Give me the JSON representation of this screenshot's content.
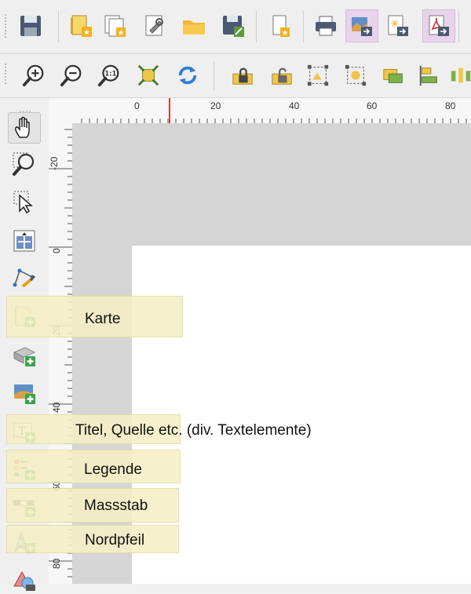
{
  "labels": {
    "karte": "Karte",
    "titel": "Titel, Quelle etc. (div. Textelemente)",
    "legende": "Legende",
    "massstab": "Massstab",
    "nordpfeil": "Nordpfeil"
  },
  "ruler": {
    "h": [
      "0",
      "20",
      "40",
      "60",
      "80"
    ],
    "v": [
      "-20",
      "0",
      "20",
      "40",
      "60",
      "80"
    ]
  },
  "zoom_label": "1:1",
  "colors": {
    "highlight": "#f5f0c6",
    "pdf": "#d32f2f",
    "marker": "#e53935"
  }
}
